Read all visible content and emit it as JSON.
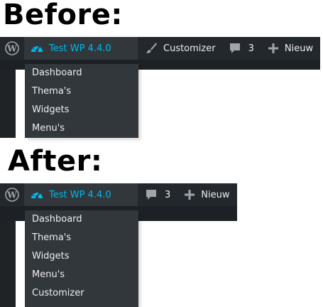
{
  "before": {
    "heading": "Before:",
    "adminbar": {
      "site_name": "Test WP 4.4.0",
      "customizer_label": "Customizer",
      "comments_count": "3",
      "new_label": "Nieuw"
    },
    "menu": [
      "Dashboard",
      "Thema's",
      "Widgets",
      "Menu's"
    ]
  },
  "after": {
    "heading": "After:",
    "adminbar": {
      "site_name": "Test WP 4.4.0",
      "comments_count": "3",
      "new_label": "Nieuw"
    },
    "menu": [
      "Dashboard",
      "Thema's",
      "Widgets",
      "Menu's",
      "Customizer"
    ]
  },
  "colors": {
    "adminbar_bg": "#23282d",
    "submenu_bg": "#32373c",
    "accent": "#00b9eb",
    "text": "#eeeeee"
  },
  "icons": {
    "wp": "wordpress-logo-icon",
    "dashboard": "dashboard-gauge-icon",
    "customizer": "paintbrush-icon",
    "comments": "comment-bubble-icon",
    "new": "plus-icon"
  }
}
